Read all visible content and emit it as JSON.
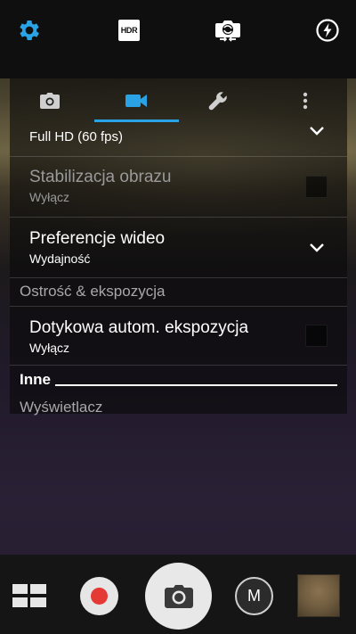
{
  "top_bar": {
    "icons": [
      "gear-icon",
      "hdr-icon",
      "switch-camera-icon",
      "flash-auto-icon"
    ],
    "hdr_text": "HDR",
    "accent_color": "#2aa3e6"
  },
  "settings_panel": {
    "tabs": [
      {
        "icon": "photo-camera-icon",
        "selected": false
      },
      {
        "icon": "video-camera-icon",
        "selected": true
      },
      {
        "icon": "wrench-icon",
        "selected": false
      },
      {
        "icon": "more-vertical-icon",
        "selected": false
      }
    ],
    "partial_row": {
      "value": "Full HD (60 fps)"
    },
    "stabilization": {
      "title": "Stabilizacja obrazu",
      "value": "Wyłącz",
      "enabled": false,
      "checked": false
    },
    "video_preference": {
      "title": "Preferencje wideo",
      "value": "Wydajność"
    },
    "section_focus": "Ostrość & ekspozycja",
    "touch_exposure": {
      "title": "Dotykowa autom. ekspozycja",
      "value": "Wyłącz",
      "checked": false
    },
    "section_other": "Inne",
    "display_item": "Wyświetlacz"
  },
  "bottom_bar": {
    "mode_label": "M",
    "record_color": "#e53935"
  }
}
